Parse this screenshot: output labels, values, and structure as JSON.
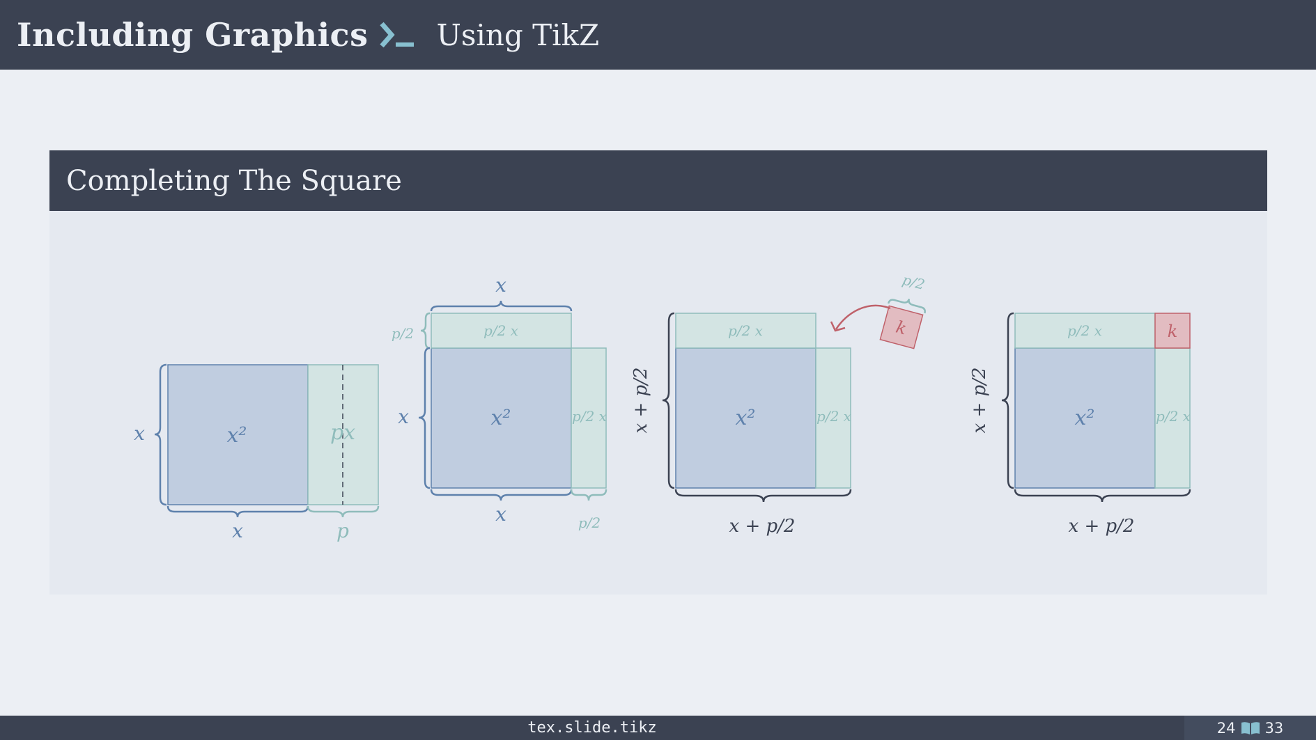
{
  "header": {
    "title": "Including Graphics",
    "subtitle": "Using TikZ",
    "prompt_icon": "terminal-prompt-icon",
    "accent_color": "#88c0d0"
  },
  "block": {
    "title": "Completing The Square"
  },
  "diagram": {
    "panel1": {
      "square_label": "x²",
      "rect_label": "px",
      "left_brace_label": "x",
      "bottom_brace_label": "x",
      "rect_brace_label": "p"
    },
    "panel2": {
      "square_label": "x²",
      "top_rect_label": "p/2 x",
      "right_rect_label": "p/2 x",
      "top_brace_label": "x",
      "left_small_brace_label": "p/2",
      "left_brace_label": "x",
      "bottom_brace_label": "x",
      "right_small_brace_label": "p/2"
    },
    "panel3": {
      "square_label": "x²",
      "top_rect_label": "p/2 x",
      "right_rect_label": "p/2 x",
      "left_brace_label": "x + p/2",
      "bottom_brace_label": "x + p/2",
      "moving_square_label": "k",
      "moving_square_brace_label": "p/2"
    },
    "panel4": {
      "square_label": "x²",
      "top_rect_label": "p/2 x",
      "right_rect_label": "p/2 x",
      "corner_square_label": "k",
      "left_brace_label": "x + p/2",
      "bottom_brace_label": "x + p/2"
    },
    "colors": {
      "blue": "#5e81ac",
      "blue_fill": "#c0cde0",
      "green": "#8fbcbb",
      "green_fill": "#d3e4e3",
      "red": "#bf616a",
      "red_fill": "#e2bcc1",
      "dark": "#3b4252"
    }
  },
  "footer": {
    "source": "tex.slide.tikz",
    "current_page": "24",
    "total_pages": "33",
    "book_icon": "book-icon"
  }
}
